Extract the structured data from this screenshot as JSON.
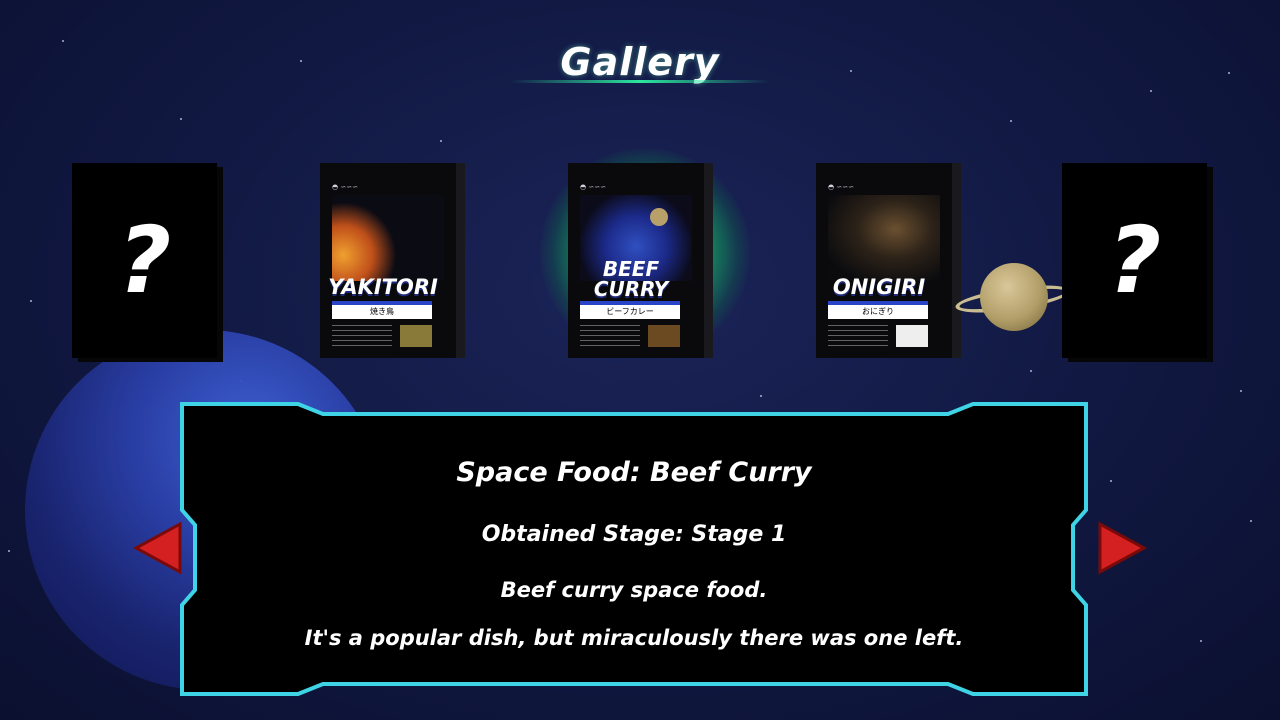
{
  "screen": {
    "title": "Gallery"
  },
  "cards": [
    {
      "state": "locked",
      "symbol": "?"
    },
    {
      "state": "unlocked",
      "name": "YAKITORI",
      "subtitle": "焼き鳥"
    },
    {
      "state": "unlocked",
      "name_line1": "BEEF",
      "name_line2": "CURRY",
      "subtitle": "ビーフカレー",
      "selected": true
    },
    {
      "state": "unlocked",
      "name": "ONIGIRI",
      "subtitle": "おにぎり"
    },
    {
      "state": "locked",
      "symbol": "?"
    }
  ],
  "details": {
    "title": "Space Food: Beef Curry",
    "stage": "Obtained Stage: Stage 1",
    "description_line1": "Beef curry space food.",
    "description_line2": "It's a popular dish, but miraculously there was one left."
  },
  "colors": {
    "panel_border": "#3fd3e6",
    "arrow": "#d42020",
    "title_underline": "#2ce7a0",
    "selected_glow": "#28e68c"
  },
  "icons": {
    "prev": "arrow-left-icon",
    "next": "arrow-right-icon"
  }
}
